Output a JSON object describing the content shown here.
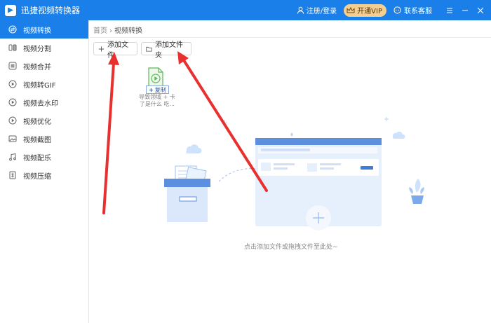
{
  "app": {
    "title": "迅捷视频转换器"
  },
  "titlebar": {
    "login": "注册/登录",
    "vip": "开通VIP",
    "service": "联系客服"
  },
  "sidebar": {
    "items": [
      {
        "label": "视频转换",
        "icon": "convert-icon",
        "active": true
      },
      {
        "label": "视频分割",
        "icon": "split-icon"
      },
      {
        "label": "视频合并",
        "icon": "merge-icon"
      },
      {
        "label": "视频转GIF",
        "icon": "gif-icon"
      },
      {
        "label": "视频去水印",
        "icon": "watermark-icon"
      },
      {
        "label": "视频优化",
        "icon": "optimize-icon"
      },
      {
        "label": "视频截图",
        "icon": "screenshot-icon"
      },
      {
        "label": "视频配乐",
        "icon": "music-icon"
      },
      {
        "label": "视频压缩",
        "icon": "compress-icon"
      }
    ]
  },
  "main": {
    "breadcrumb": {
      "home": "首页",
      "sep": "›",
      "current": "视频转换"
    },
    "add_file": "添加文件",
    "add_folder": "添加文件夹",
    "drag_item": {
      "tip": "复制",
      "name": "导致领域 + 卡了是什么 吃..."
    },
    "hint": "点击添加文件或拖拽文件至此处~"
  },
  "colors": {
    "brand": "#1a7fe8",
    "vip": "#f4cf91",
    "arrow": "#e8302f"
  }
}
